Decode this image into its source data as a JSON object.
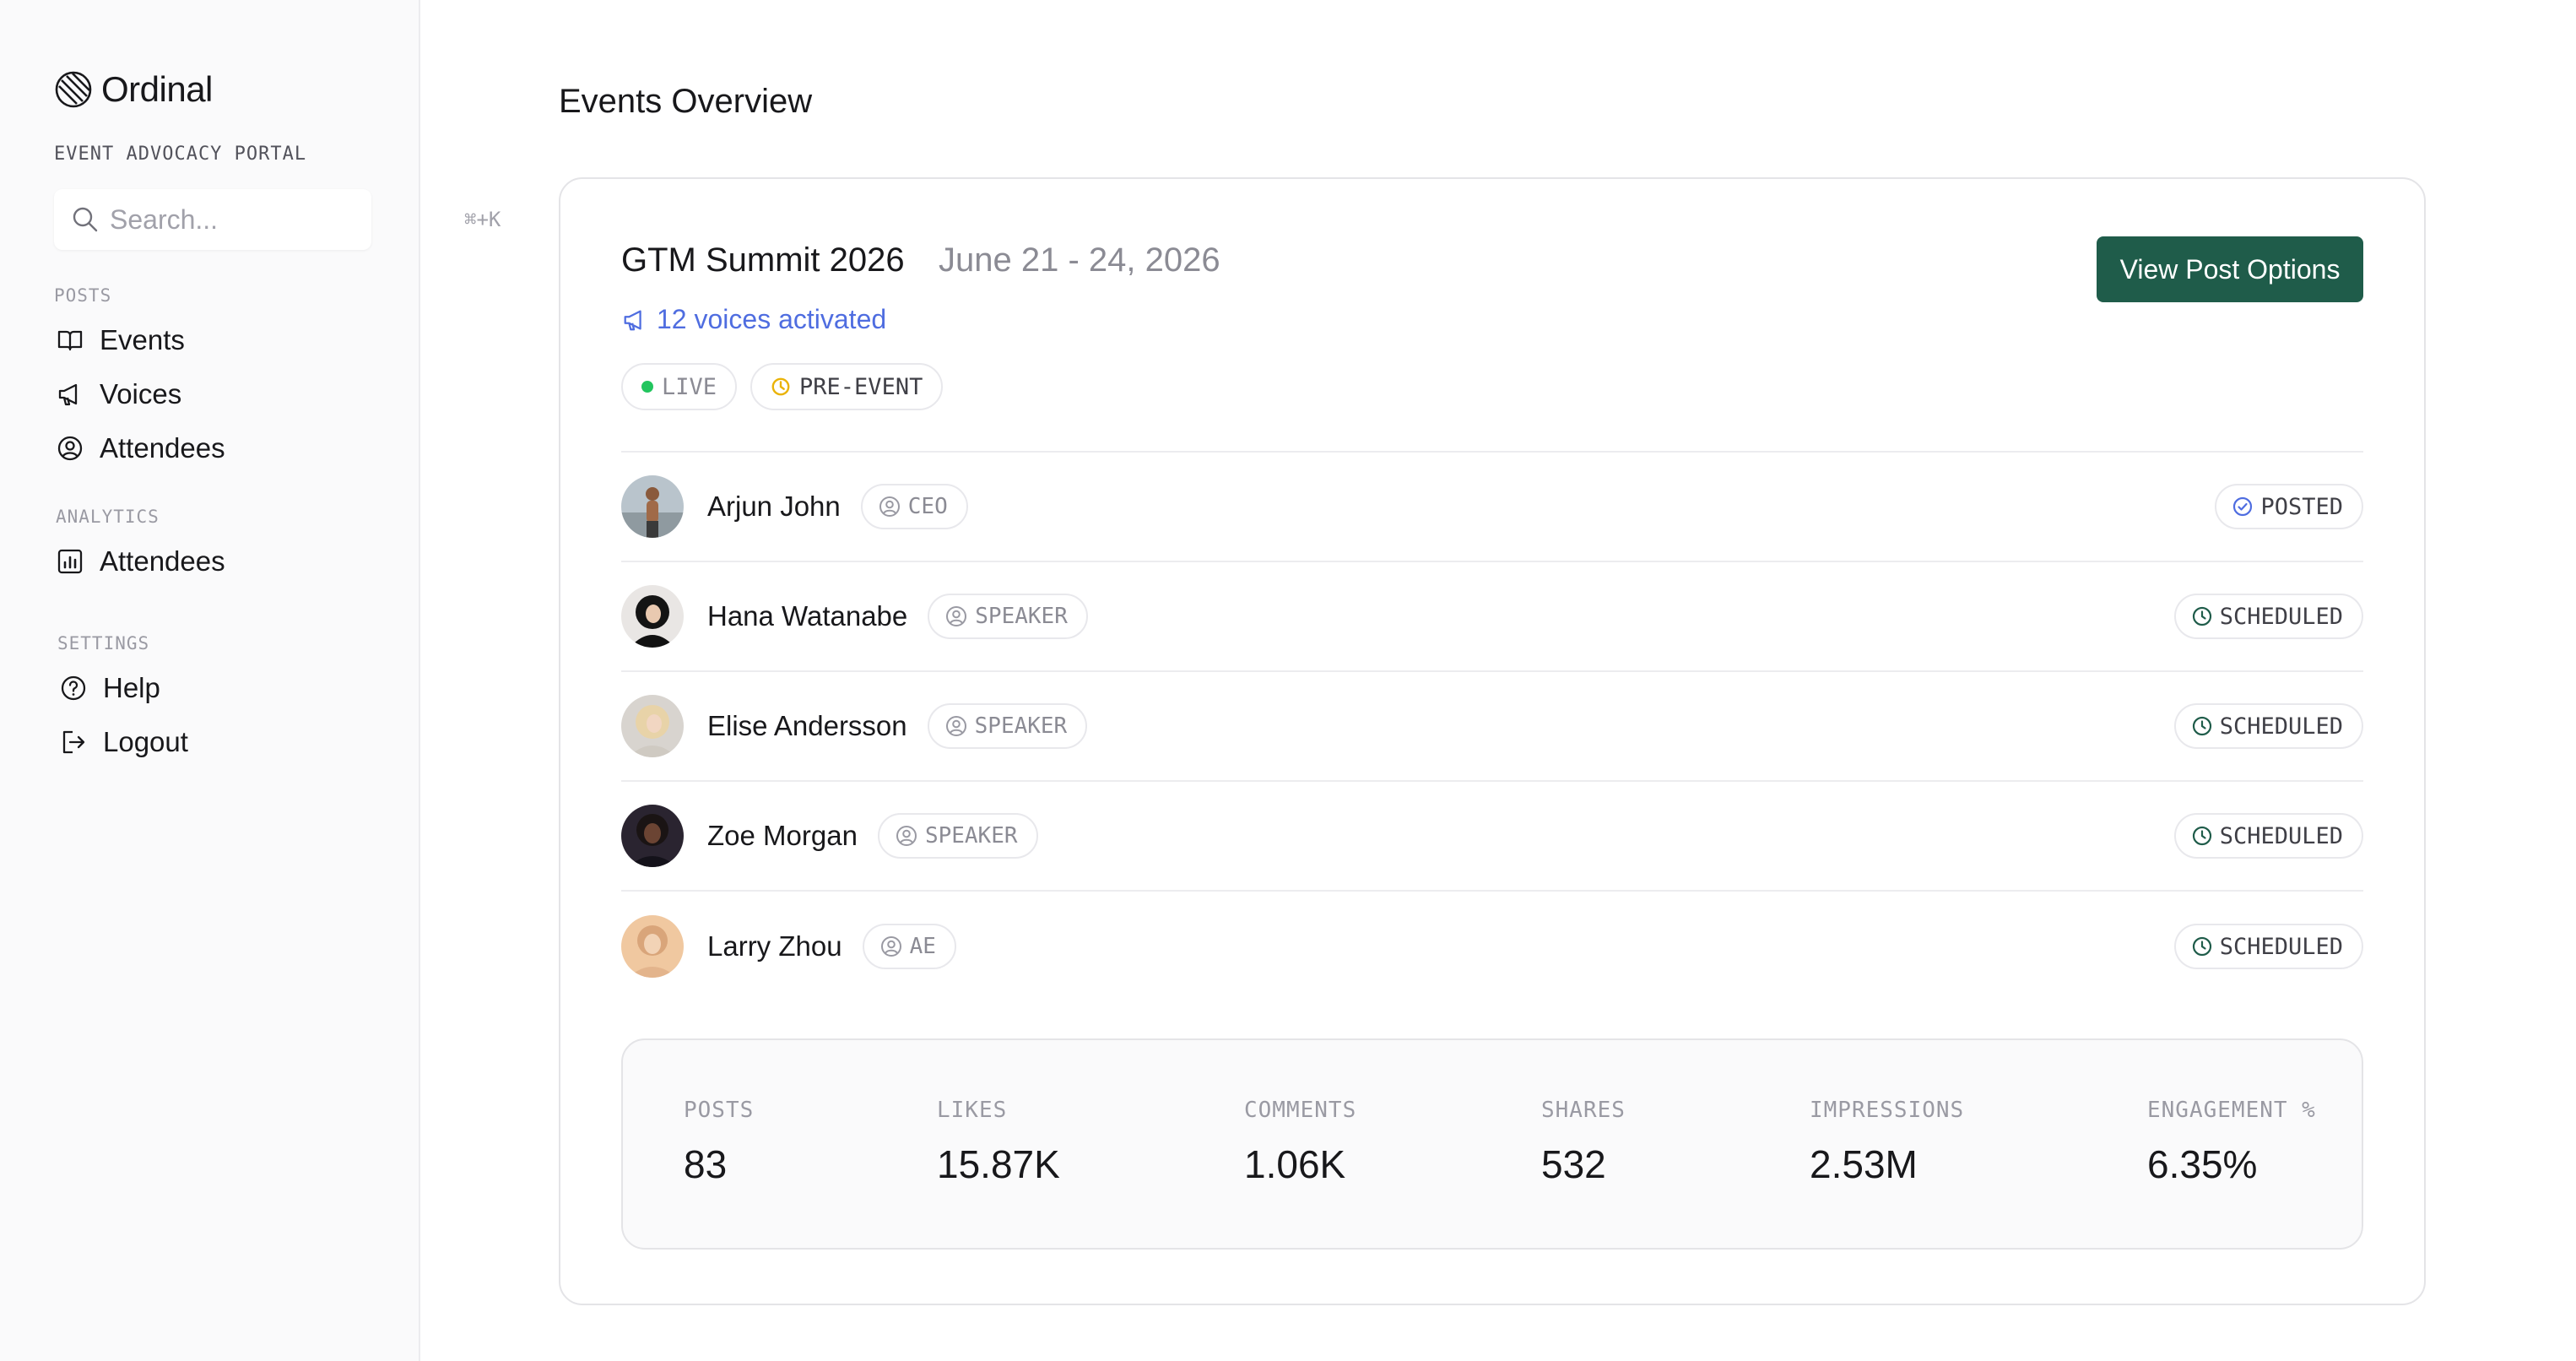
{
  "brand": {
    "name": "Ordinal",
    "subtitle": "EVENT ADVOCACY PORTAL"
  },
  "search": {
    "placeholder": "Search...",
    "shortcut": "⌘+K"
  },
  "sidebar": {
    "posts_label": "POSTS",
    "posts_items": [
      {
        "label": "Events",
        "icon": "book-open-icon"
      },
      {
        "label": "Voices",
        "icon": "megaphone-icon"
      },
      {
        "label": "Attendees",
        "icon": "user-circle-icon"
      }
    ],
    "analytics_label": "ANALYTICS",
    "analytics_items": [
      {
        "label": "Attendees",
        "icon": "bar-chart-icon"
      }
    ],
    "settings_label": "SETTINGS",
    "settings_items": [
      {
        "label": "Help",
        "icon": "help-circle-icon"
      },
      {
        "label": "Logout",
        "icon": "logout-icon"
      }
    ]
  },
  "page": {
    "title": "Events Overview"
  },
  "event": {
    "title": "GTM Summit 2026",
    "date": "June 21 - 24, 2026",
    "voices": "12 voices activated",
    "live_label": "LIVE",
    "phase_label": "PRE-EVENT",
    "action_label": "View Post Options",
    "accent_color": "#1f5c4a",
    "link_color": "#4f6de0"
  },
  "people": [
    {
      "name": "Arjun John",
      "role": "CEO",
      "status": "POSTED"
    },
    {
      "name": "Hana Watanabe",
      "role": "SPEAKER",
      "status": "SCHEDULED"
    },
    {
      "name": "Elise Andersson",
      "role": "SPEAKER",
      "status": "SCHEDULED"
    },
    {
      "name": "Zoe Morgan",
      "role": "SPEAKER",
      "status": "SCHEDULED"
    },
    {
      "name": "Larry Zhou",
      "role": "AE",
      "status": "SCHEDULED"
    }
  ],
  "stats": [
    {
      "label": "POSTS",
      "value": "83"
    },
    {
      "label": "LIKES",
      "value": "15.87K"
    },
    {
      "label": "COMMENTS",
      "value": "1.06K"
    },
    {
      "label": "SHARES",
      "value": "532"
    },
    {
      "label": "IMPRESSIONS",
      "value": "2.53M"
    },
    {
      "label": "ENGAGEMENT %",
      "value": "6.35%"
    }
  ]
}
